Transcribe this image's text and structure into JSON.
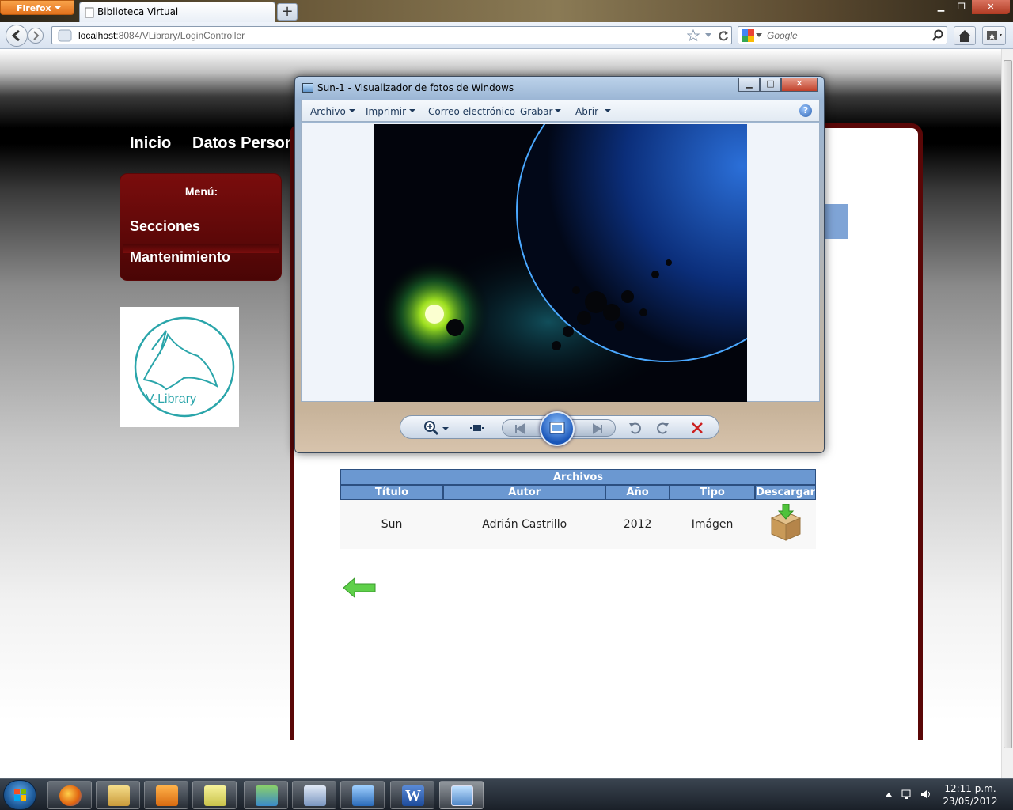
{
  "browser": {
    "app_button": "Firefox",
    "tab_title": "Biblioteca Virtual",
    "url_host": "localhost",
    "url_rest": ":8084/VLibrary/LoginController",
    "search_placeholder": "Google"
  },
  "site": {
    "nav": [
      "Inicio",
      "Datos Person"
    ],
    "menu_title": "Menú:",
    "menu_items": [
      "Secciones",
      "Mantenimiento"
    ],
    "logo_text": "V-Library",
    "table": {
      "caption": "Archivos",
      "headers": [
        "Título",
        "Autor",
        "Año",
        "Tipo",
        "Descargar"
      ],
      "rows": [
        {
          "titulo": "Sun",
          "autor": "Adrián Castrillo",
          "anio": "2012",
          "tipo": "Imágen"
        }
      ]
    }
  },
  "viewer": {
    "title": "Sun-1 - Visualizador de fotos de Windows",
    "menu": [
      "Archivo",
      "Imprimir",
      "Correo electrónico",
      "Grabar",
      "Abrir"
    ],
    "help": "?"
  },
  "taskbar": {
    "time": "12:11 p.m.",
    "date": "23/05/2012"
  },
  "colors": {
    "menu_red": "#7a0d0d",
    "table_header_blue": "#6b98d1",
    "logo_teal": "#2aa5aa"
  }
}
